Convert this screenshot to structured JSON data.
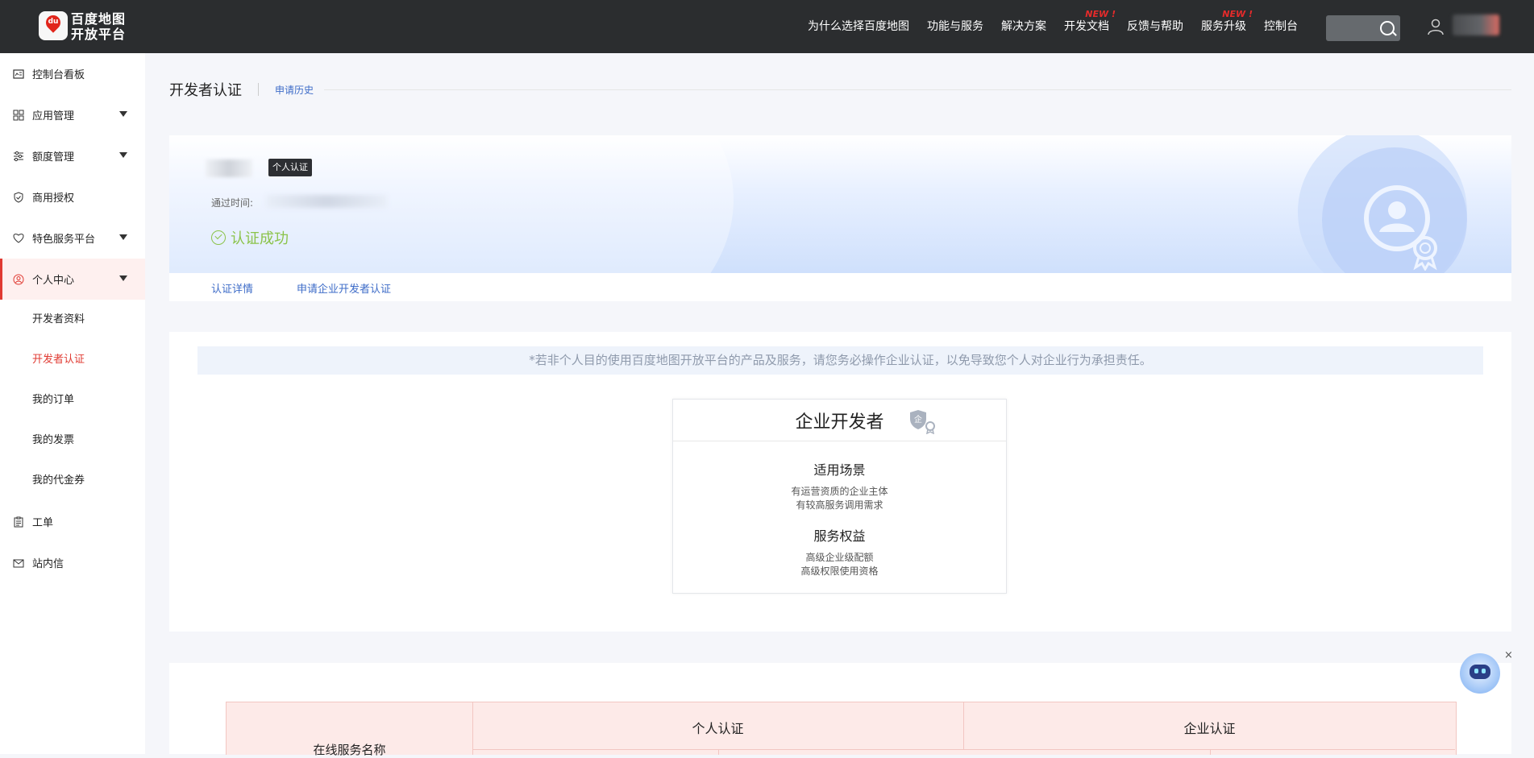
{
  "header": {
    "logo_badge": "du",
    "logo_line1": "百度地图",
    "logo_line2": "开放平台",
    "nav": [
      {
        "label": "为什么选择百度地图",
        "tag": ""
      },
      {
        "label": "功能与服务",
        "tag": ""
      },
      {
        "label": "解决方案",
        "tag": ""
      },
      {
        "label": "开发文档",
        "tag": "NEW !"
      },
      {
        "label": "反馈与帮助",
        "tag": ""
      },
      {
        "label": "服务升级",
        "tag": "NEW !"
      },
      {
        "label": "控制台",
        "tag": ""
      }
    ],
    "search_icon": "search-icon",
    "user_icon": "user-icon"
  },
  "sidebar": {
    "items": [
      {
        "label": "控制台看板",
        "icon": "dashboard-icon"
      },
      {
        "label": "应用管理",
        "icon": "grid-icon"
      },
      {
        "label": "额度管理",
        "icon": "sliders-icon"
      },
      {
        "label": "商用授权",
        "icon": "shield-check-icon"
      },
      {
        "label": "特色服务平台",
        "icon": "heart-shield-icon"
      },
      {
        "label": "个人中心",
        "icon": "user-circle-icon"
      },
      {
        "label": "工单",
        "icon": "clipboard-icon"
      },
      {
        "label": "站内信",
        "icon": "mail-icon"
      }
    ],
    "sub_items": [
      "开发者资料",
      "开发者认证",
      "我的订单",
      "我的发票",
      "我的代金券"
    ]
  },
  "main": {
    "title": "开发者认证",
    "history_link": "申请历史",
    "banner": {
      "tag": "个人认证",
      "pass_time_label": "通过时间:",
      "status": "认证成功",
      "links": [
        "认证详情",
        "申请企业开发者认证"
      ]
    },
    "notice": "*若非个人目的使用百度地图开放平台的产品及服务，请您务必操作企业认证，以免导致您个人对企业行为承担责任。",
    "enterprise_card": {
      "title": "企业开发者",
      "scene_title": "适用场景",
      "scene_lines": [
        "有运营资质的企业主体",
        "有较高服务调用需求"
      ],
      "benefit_title": "服务权益",
      "benefit_lines": [
        "高级企业级配额",
        "高级权限使用资格"
      ]
    },
    "compare_table": {
      "col1": "在线服务名称",
      "headers": [
        "个人认证",
        "企业认证"
      ]
    }
  },
  "assistant": {
    "close_label": "×"
  },
  "colors": {
    "accent": "#e03a32",
    "link": "#3e6cc8",
    "success": "#8bc34a",
    "topbar": "#2b2d2f"
  }
}
